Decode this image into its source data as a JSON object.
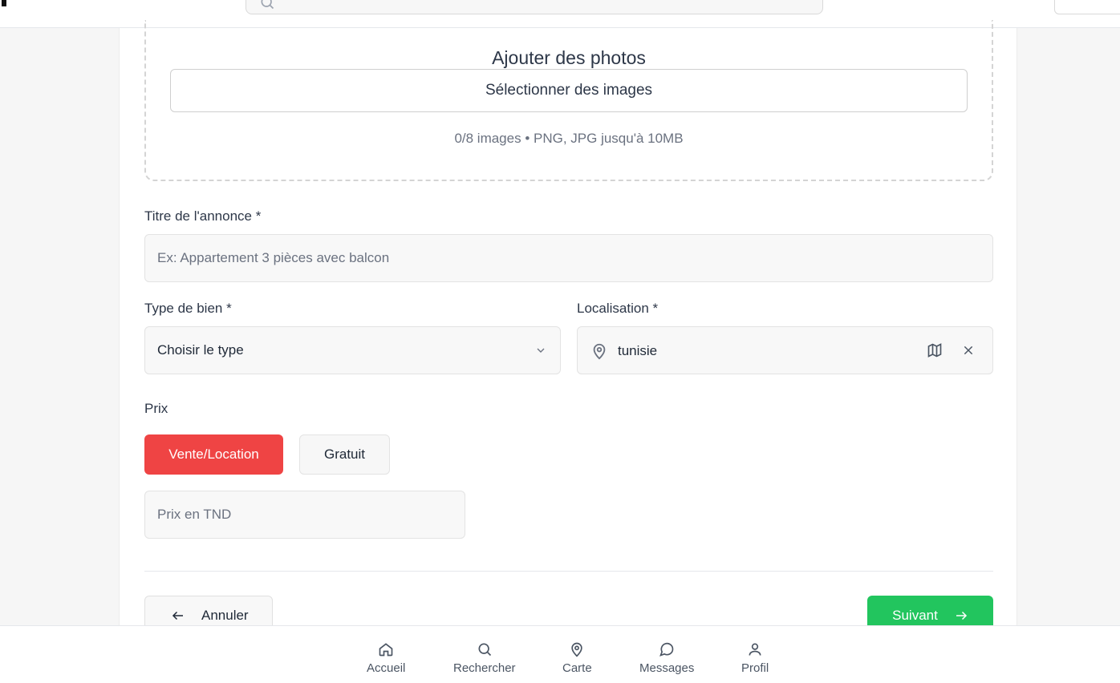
{
  "upload": {
    "title": "Ajouter des photos",
    "select_label": "Sélectionner des images",
    "hint": "0/8 images • PNG, JPG jusqu'à 10MB"
  },
  "form": {
    "title_label": "Titre de l'annonce *",
    "title_placeholder": "Ex: Appartement 3 pièces avec balcon",
    "type_label": "Type de bien *",
    "type_value": "Choisir le type",
    "location_label": "Localisation *",
    "location_value": "tunisie",
    "price_label": "Prix",
    "price_options": [
      "Vente/Location",
      "Gratuit"
    ],
    "price_placeholder": "Prix en TND"
  },
  "actions": {
    "cancel_label": "Annuler",
    "next_label": "Suivant"
  },
  "nav": {
    "items": [
      "Accueil",
      "Rechercher",
      "Carte",
      "Messages",
      "Profil"
    ]
  },
  "colors": {
    "accent_red": "#ef4444",
    "accent_green": "#22c55e"
  }
}
